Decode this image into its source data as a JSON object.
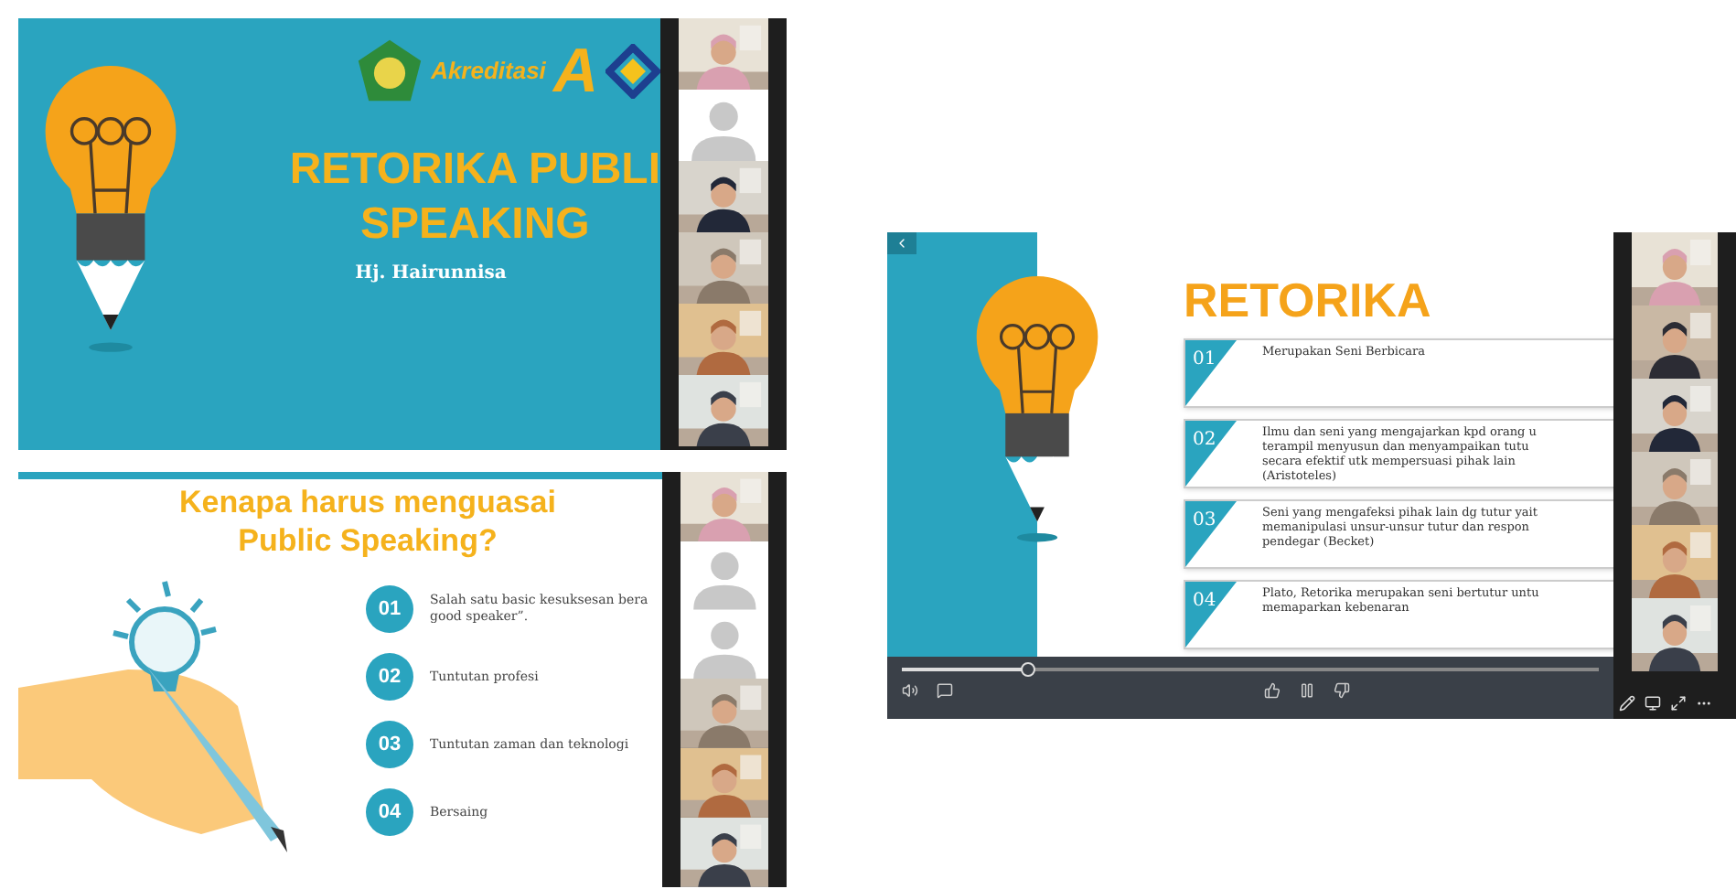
{
  "screens": [
    {
      "slide": {
        "kind": "title",
        "logo_text": "Akreditasi",
        "logo_letter": "A",
        "title_lines": [
          "RETORIKA PUBLI",
          "SPEAKING"
        ],
        "subtitle": "Hj. Hairunnisa"
      },
      "participants": [
        {
          "kind": "video"
        },
        {
          "kind": "avatar"
        },
        {
          "kind": "video"
        },
        {
          "kind": "video"
        },
        {
          "kind": "video"
        },
        {
          "kind": "video"
        }
      ]
    },
    {
      "slide": {
        "kind": "list",
        "title_lines": [
          "Kenapa harus menguasai",
          "Public Speaking?"
        ],
        "items": [
          {
            "number": "01",
            "lines": [
              "Salah satu basic kesuksesan bera",
              "good speaker”."
            ]
          },
          {
            "number": "02",
            "lines": [
              "Tuntutan profesi"
            ]
          },
          {
            "number": "03",
            "lines": [
              "Tuntutan zaman dan teknologi"
            ]
          },
          {
            "number": "04",
            "lines": [
              "Bersaing"
            ]
          }
        ]
      },
      "participants": [
        {
          "kind": "video"
        },
        {
          "kind": "avatar"
        },
        {
          "kind": "avatar"
        },
        {
          "kind": "video"
        },
        {
          "kind": "video"
        },
        {
          "kind": "video"
        }
      ]
    },
    {
      "slide": {
        "kind": "boxes",
        "title_lines": [
          "RETORIKA"
        ],
        "items": [
          {
            "number": "01",
            "lines": [
              "Merupakan Seni Berbicara"
            ]
          },
          {
            "number": "02",
            "lines": [
              "Ilmu dan seni yang mengajarkan kpd orang u",
              "terampil menyusun dan menyampaikan  tutu",
              "secara efektif utk mempersuasi pihak lain",
              "(Aristoteles)"
            ]
          },
          {
            "number": "03",
            "lines": [
              "Seni yang mengafeksi pihak lain dg tutur yait",
              "memanipulasi unsur-unsur tutur dan respon",
              "pendegar (Becket)"
            ]
          },
          {
            "number": "04",
            "lines": [
              "Plato, Retorika merupakan seni bertutur untu",
              "memaparkan kebenaran"
            ]
          }
        ],
        "player": {
          "level": 0.18
        }
      },
      "participants": [
        {
          "kind": "video"
        },
        {
          "kind": "video"
        },
        {
          "kind": "video"
        },
        {
          "kind": "video"
        },
        {
          "kind": "video"
        },
        {
          "kind": "video"
        }
      ]
    }
  ]
}
